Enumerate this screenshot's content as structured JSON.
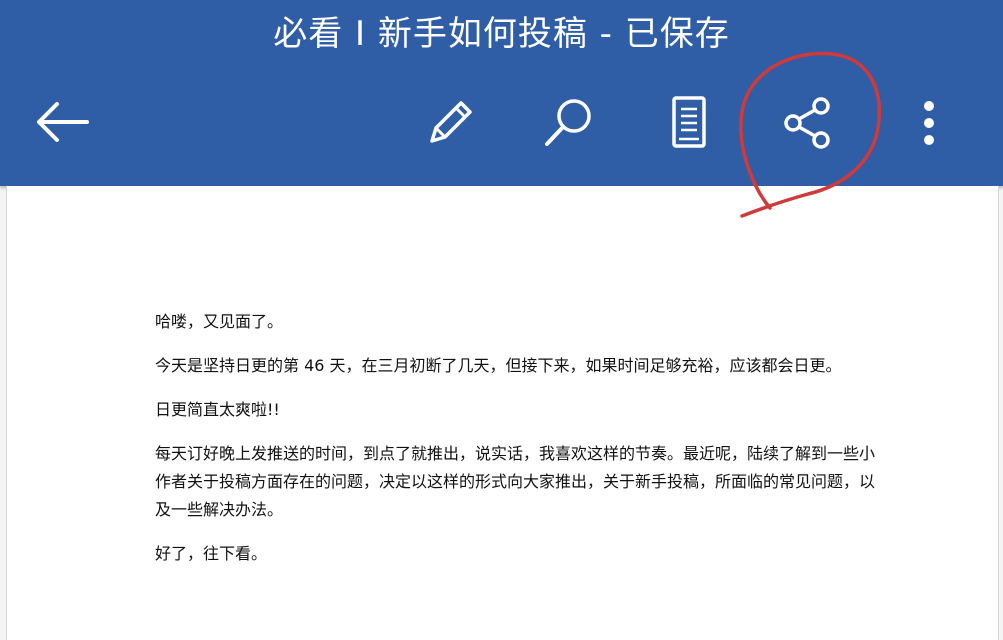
{
  "header": {
    "title": "必看 I 新手如何投稿 - 已保存",
    "icons": [
      "back-arrow-icon",
      "pencil-icon",
      "search-icon",
      "document-view-icon",
      "share-icon",
      "more-vertical-icon"
    ]
  },
  "document": {
    "paragraphs": [
      "哈喽，又见面了。",
      "今天是坚持日更的第 46 天，在三月初断了几天，但接下来，如果时间足够充裕，应该都会日更。",
      "日更简直太爽啦!!",
      "每天订好晚上发推送的时间，到点了就推出，说实话，我喜欢这样的节奏。最近呢，陆续了解到一些小作者关于投稿方面存在的问题，决定以这样的形式向大家推出，关于新手投稿，所面临的常见问题，以及一些解决办法。",
      "好了，往下看。"
    ]
  },
  "colors": {
    "header_bg": "#2f5da6",
    "icon": "#ffffff",
    "annotation": "#d03a3a"
  }
}
